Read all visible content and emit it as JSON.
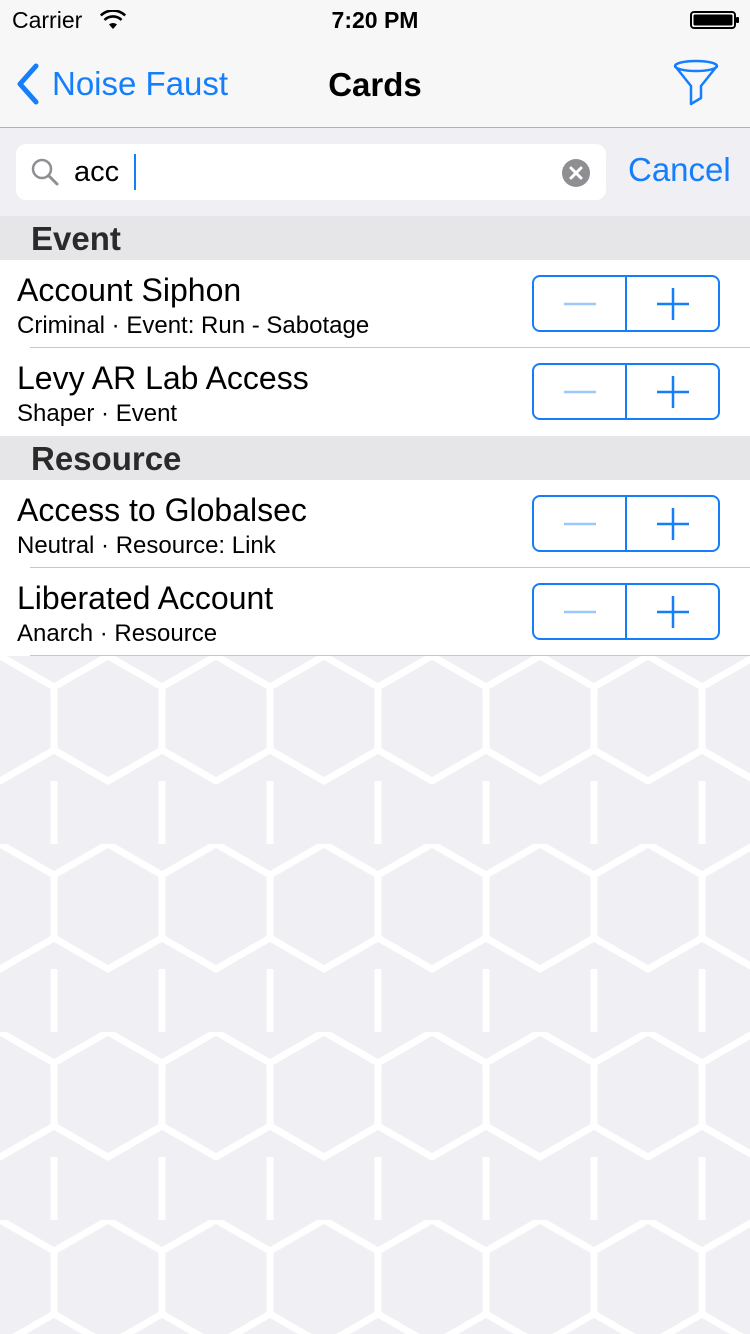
{
  "status_bar": {
    "carrier": "Carrier",
    "time": "7:20 PM"
  },
  "nav": {
    "back_label": "Noise Faust",
    "title": "Cards"
  },
  "search": {
    "query": "acc",
    "cancel_label": "Cancel"
  },
  "sections": [
    {
      "header": "Event",
      "rows": [
        {
          "title": "Account Siphon",
          "subtitle": "Criminal · Event: Run - Sabotage"
        },
        {
          "title": "Levy AR Lab Access",
          "subtitle": "Shaper · Event"
        }
      ]
    },
    {
      "header": "Resource",
      "rows": [
        {
          "title": "Access to Globalsec",
          "subtitle": "Neutral · Resource: Link"
        },
        {
          "title": "Liberated Account",
          "subtitle": "Anarch · Resource"
        }
      ]
    }
  ],
  "colors": {
    "accent": "#147efb",
    "background": "#efeff4",
    "section_header": "#e6e6e9"
  },
  "icons": [
    "wifi-icon",
    "battery-icon",
    "back-chevron-icon",
    "filter-icon",
    "search-icon",
    "clear-icon",
    "minus-icon",
    "plus-icon"
  ]
}
